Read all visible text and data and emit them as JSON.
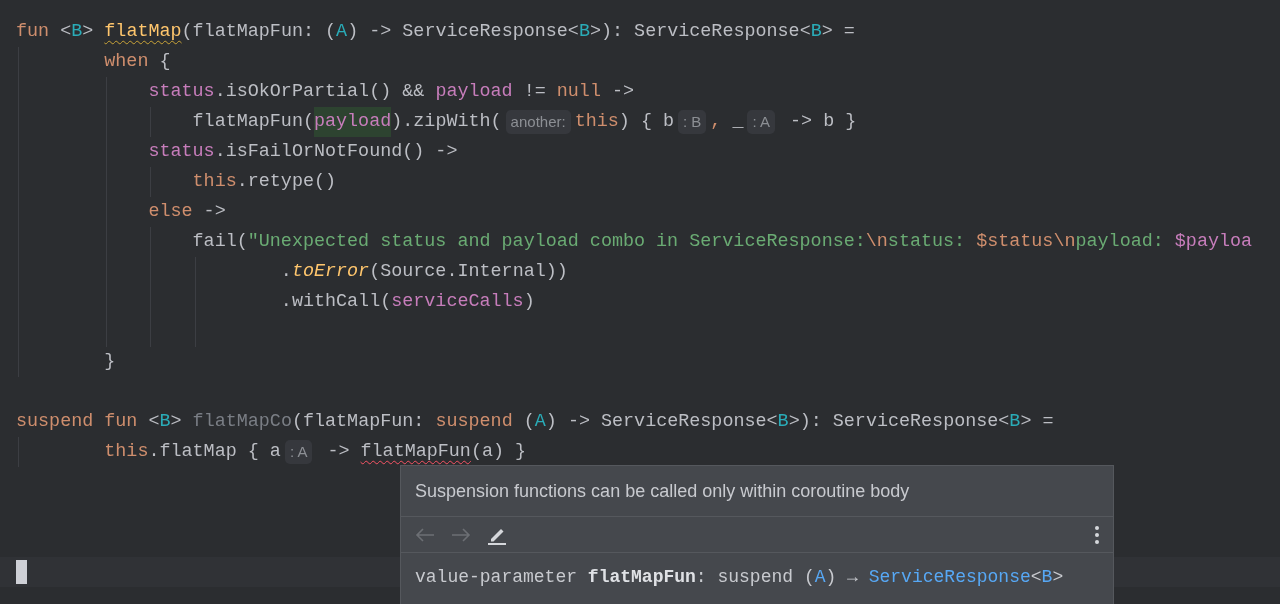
{
  "editor": {
    "lines": [
      {
        "kind": "continuation",
        "tokens": [
          {
            "kind": "keyword",
            "text": "fun"
          },
          {
            "kind": "plain",
            "text": " <"
          },
          {
            "kind": "type-param",
            "text": "B"
          },
          {
            "kind": "plain",
            "text": "> "
          },
          {
            "kind": "function-decl",
            "text": "flatMap",
            "warning": true
          },
          {
            "kind": "plain",
            "text": "(flatMapFun: ("
          },
          {
            "kind": "type-param",
            "text": "A"
          },
          {
            "kind": "plain",
            "text": ") -> ServiceResponse<"
          },
          {
            "kind": "type-param",
            "text": "B"
          },
          {
            "kind": "plain",
            "text": ">): ServiceResponse<"
          },
          {
            "kind": "type-param",
            "text": "B"
          },
          {
            "kind": "plain",
            "text": "> ="
          }
        ],
        "children": [
          {
            "kind": "block",
            "tokens": [
              {
                "kind": "keyword",
                "text": "when"
              },
              {
                "kind": "plain",
                "text": " {"
              }
            ],
            "children": [
              {
                "kind": "block",
                "tokens": [
                  {
                    "kind": "property",
                    "text": "status"
                  },
                  {
                    "kind": "plain",
                    "text": ".isOkOrPartial() && "
                  },
                  {
                    "kind": "property",
                    "text": "payload"
                  },
                  {
                    "kind": "plain",
                    "text": " != "
                  },
                  {
                    "kind": "keyword",
                    "text": "null"
                  },
                  {
                    "kind": "plain",
                    "text": " ->"
                  }
                ],
                "children": [
                  {
                    "tokens": [
                      {
                        "kind": "plain",
                        "text": "flatMapFun("
                      },
                      {
                        "kind": "property",
                        "text": "payload",
                        "highlighted": true
                      },
                      {
                        "kind": "plain",
                        "text": ").zipWith("
                      },
                      {
                        "kind": "hint",
                        "text": "another:"
                      },
                      {
                        "kind": "keyword",
                        "text": "this"
                      },
                      {
                        "kind": "plain",
                        "text": ") { b"
                      },
                      {
                        "kind": "hint",
                        "text": ": B"
                      },
                      {
                        "kind": "keyword",
                        "text": ","
                      },
                      {
                        "kind": "plain",
                        "text": " _"
                      },
                      {
                        "kind": "hint",
                        "text": ": A"
                      },
                      {
                        "kind": "plain",
                        "text": " -> b }"
                      }
                    ]
                  }
                ]
              },
              {
                "kind": "block",
                "tokens": [
                  {
                    "kind": "property",
                    "text": "status"
                  },
                  {
                    "kind": "plain",
                    "text": ".isFailOrNotFound() ->"
                  }
                ],
                "children": [
                  {
                    "tokens": [
                      {
                        "kind": "keyword",
                        "text": "this"
                      },
                      {
                        "kind": "plain",
                        "text": ".retype()"
                      }
                    ]
                  }
                ]
              },
              {
                "kind": "block",
                "tokens": [
                  {
                    "kind": "keyword",
                    "text": "else"
                  },
                  {
                    "kind": "plain",
                    "text": " ->"
                  }
                ],
                "children": [
                  {
                    "kind": "continuation",
                    "tokens": [
                      {
                        "kind": "plain",
                        "text": "fail("
                      },
                      {
                        "kind": "string",
                        "text": "\"Unexpected status and payload combo in ServiceResponse:"
                      },
                      {
                        "kind": "escape",
                        "text": "\\n"
                      },
                      {
                        "kind": "string",
                        "text": "status: "
                      },
                      {
                        "kind": "template",
                        "text": "$status"
                      },
                      {
                        "kind": "escape",
                        "text": "\\n"
                      },
                      {
                        "kind": "string",
                        "text": "payload: "
                      },
                      {
                        "kind": "property",
                        "text": "$payloa"
                      }
                    ],
                    "children": [
                      {
                        "tokens": [
                          {
                            "kind": "plain",
                            "text": "."
                          },
                          {
                            "kind": "call-italic",
                            "text": "toError"
                          },
                          {
                            "kind": "plain",
                            "text": "(Source.Internal))"
                          }
                        ]
                      },
                      {
                        "tokens": [
                          {
                            "kind": "plain",
                            "text": ".withCall("
                          },
                          {
                            "kind": "property",
                            "text": "serviceCalls"
                          },
                          {
                            "kind": "plain",
                            "text": ")"
                          }
                        ]
                      },
                      {
                        "blank": true
                      }
                    ]
                  }
                ]
              }
            ]
          },
          {
            "tokens": [
              {
                "kind": "plain",
                "text": "}"
              }
            ]
          }
        ]
      },
      {
        "blank": true
      },
      {
        "kind": "continuation",
        "tokens": [
          {
            "kind": "keyword",
            "text": "suspend fun"
          },
          {
            "kind": "plain",
            "text": " <"
          },
          {
            "kind": "type-param",
            "text": "B"
          },
          {
            "kind": "plain",
            "text": "> "
          },
          {
            "kind": "unused",
            "text": "flatMapCo"
          },
          {
            "kind": "plain",
            "text": "(flatMapFun: "
          },
          {
            "kind": "keyword",
            "text": "suspend"
          },
          {
            "kind": "plain",
            "text": " ("
          },
          {
            "kind": "type-param",
            "text": "A"
          },
          {
            "kind": "plain",
            "text": ") -> ServiceResponse<"
          },
          {
            "kind": "type-param",
            "text": "B"
          },
          {
            "kind": "plain",
            "text": ">): ServiceResponse<"
          },
          {
            "kind": "type-param",
            "text": "B"
          },
          {
            "kind": "plain",
            "text": "> ="
          }
        ],
        "children": [
          {
            "tokens": [
              {
                "kind": "keyword",
                "text": "this"
              },
              {
                "kind": "plain",
                "text": ".flatMap { a"
              },
              {
                "kind": "hint",
                "text": ": A"
              },
              {
                "kind": "plain",
                "text": " -> "
              },
              {
                "kind": "plain",
                "text": "flatMapFun",
                "error": true
              },
              {
                "kind": "plain",
                "text": "(a) }"
              }
            ]
          }
        ]
      },
      {
        "blank": true
      },
      {
        "blank": true
      },
      {
        "blank": true
      },
      {
        "blank": true,
        "caret": true
      }
    ]
  },
  "popup": {
    "message": "Suspension functions can be called only within coroutine body",
    "toolbar": [
      {
        "kind": "back",
        "disabled": true
      },
      {
        "kind": "forward",
        "disabled": true
      },
      {
        "kind": "edit",
        "disabled": false
      },
      {
        "kind": "more",
        "disabled": false
      }
    ],
    "doc": [
      {
        "kind": "plain",
        "text": "value-parameter "
      },
      {
        "kind": "bold",
        "text": "flatMapFun"
      },
      {
        "kind": "plain",
        "text": ": suspend ("
      },
      {
        "kind": "type",
        "text": "A"
      },
      {
        "kind": "plain",
        "text": ") → "
      },
      {
        "kind": "link",
        "text": "ServiceResponse"
      },
      {
        "kind": "plain",
        "text": "<"
      },
      {
        "kind": "type",
        "text": "B"
      },
      {
        "kind": "plain",
        "text": ">"
      }
    ]
  }
}
